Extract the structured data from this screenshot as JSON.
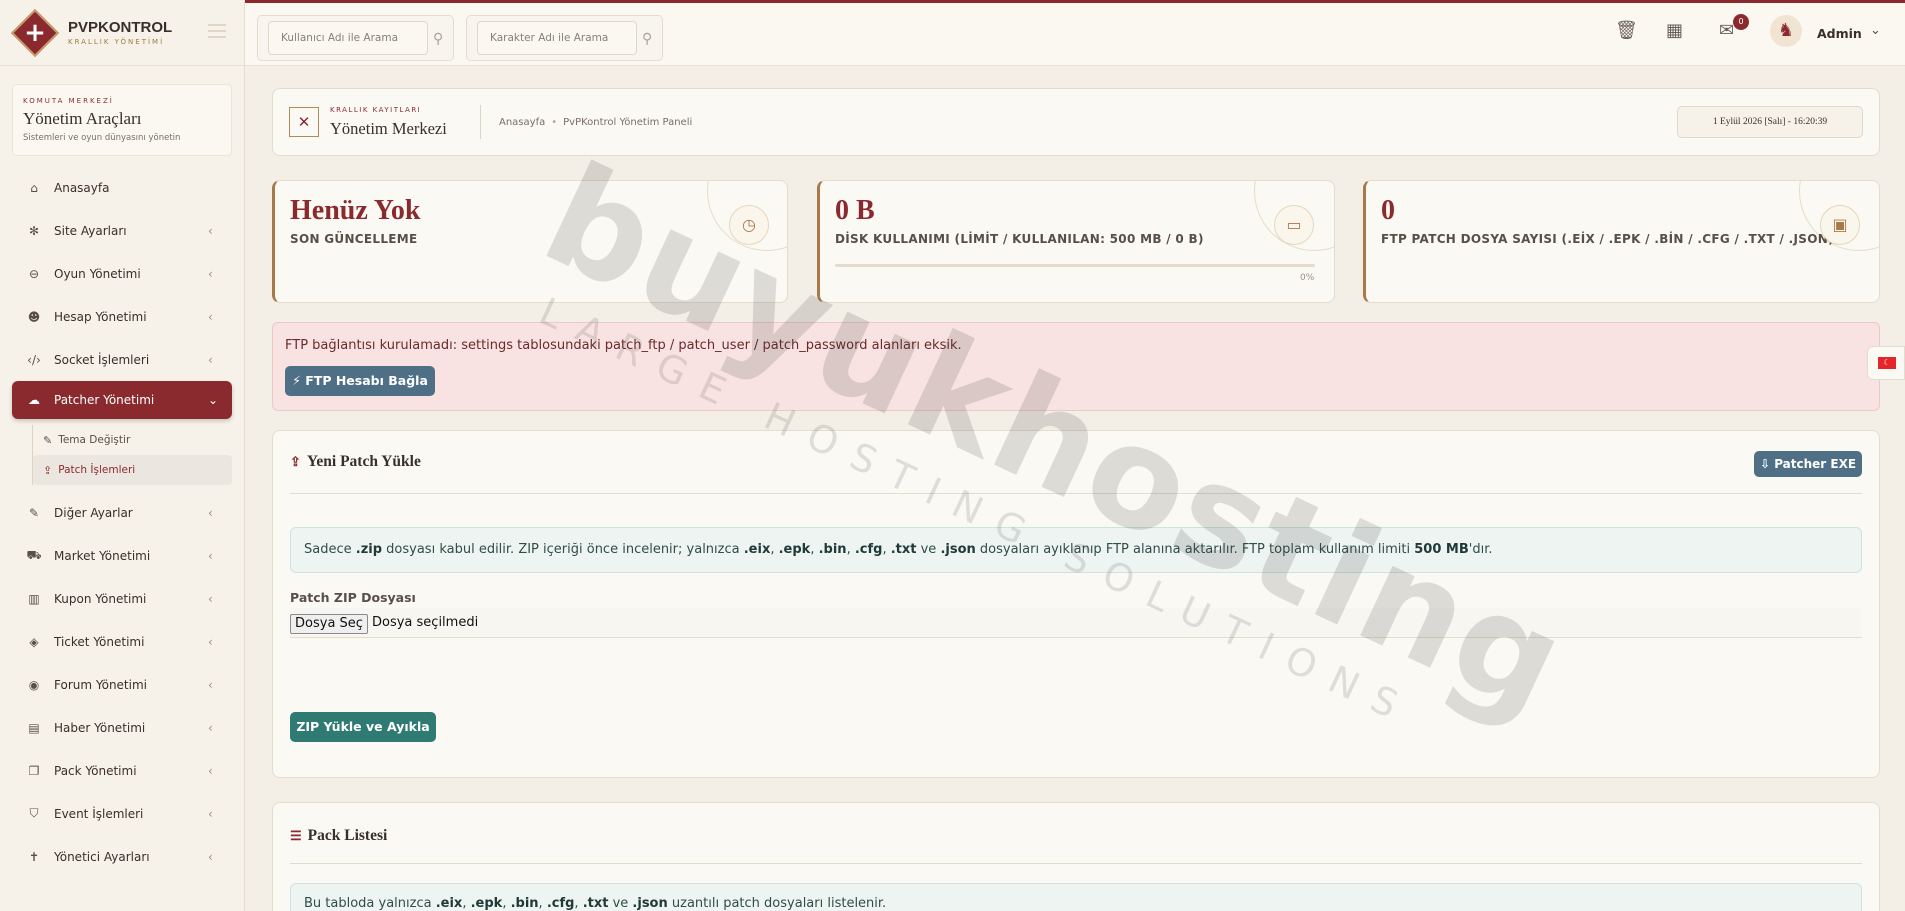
{
  "brand": {
    "title": "PVPKONTROL",
    "subtitle": "KRALLIK YÖNETİMİ"
  },
  "command_box": {
    "kicker": "KOMUTA MERKEZİ",
    "title": "Yönetim Araçları",
    "description": "Sistemleri ve oyun dünyasını yönetin"
  },
  "sidebar": {
    "items": [
      {
        "label": "Anasayfa",
        "icon": "home-icon"
      },
      {
        "label": "Site Ayarları",
        "icon": "gear-icon"
      },
      {
        "label": "Oyun Yönetimi",
        "icon": "gamepad-icon"
      },
      {
        "label": "Hesap Yönetimi",
        "icon": "users-icon"
      },
      {
        "label": "Socket İşlemleri",
        "icon": "code-icon"
      },
      {
        "label": "Patcher Yönetimi",
        "icon": "cloud-upload-icon"
      },
      {
        "label": "Diğer Ayarlar",
        "icon": "wrench-icon"
      },
      {
        "label": "Market Yönetimi",
        "icon": "cart-icon"
      },
      {
        "label": "Kupon Yönetimi",
        "icon": "barcode-icon"
      },
      {
        "label": "Ticket Yönetimi",
        "icon": "tag-icon"
      },
      {
        "label": "Forum Yönetimi",
        "icon": "comments-icon"
      },
      {
        "label": "Haber Yönetimi",
        "icon": "newspaper-icon"
      },
      {
        "label": "Pack Yönetimi",
        "icon": "copy-icon"
      },
      {
        "label": "Event İşlemleri",
        "icon": "shield-icon"
      },
      {
        "label": "Yönetici Ayarları",
        "icon": "user-tie-icon"
      }
    ],
    "sub_items": [
      {
        "label": "Tema Değiştir",
        "icon": "brush-icon"
      },
      {
        "label": "Patch İşlemleri",
        "icon": "upload-icon"
      }
    ]
  },
  "topbar": {
    "search_user_placeholder": "Kullanıcı Adı ile Arama",
    "search_char_placeholder": "Karakter Adı ile Arama",
    "notification_count": "0",
    "user_name": "Admin"
  },
  "header": {
    "kicker": "KRALLIK KAYITLARI",
    "title": "Yönetim Merkezi",
    "breadcrumb": [
      "Anasayfa",
      "PvPKontrol Yönetim Paneli"
    ],
    "datetime": "1 Eylül 2026 [Salı] - 16:20:39"
  },
  "stats": [
    {
      "value": "Henüz Yok",
      "label": "SON GÜNCELLEME",
      "icon": "clock-icon"
    },
    {
      "value": "0 B",
      "label": "DİSK KULLANIMI (LİMİT / KULLANILAN: 500 MB / 0 B)",
      "icon": "hdd-icon",
      "progress": 0,
      "progress_label": "0%"
    },
    {
      "value": "0",
      "label": "FTP PATCH DOSYA SAYISI (.EİX / .EPK / .BİN / .CFG / .TXT / .JSON)",
      "icon": "archive-icon"
    }
  ],
  "alert": {
    "text": "FTP bağlantısı kurulamadı: settings tablosundaki patch_ftp / patch_user / patch_password alanları eksik.",
    "button_label": "FTP Hesabı Bağla"
  },
  "upload_panel": {
    "title": "Yeni Patch Yükle",
    "exe_button": "Patcher EXE",
    "info": {
      "t1": "Sadece ",
      "b1": ".zip",
      "t2": " dosyası kabul edilir. ZIP içeriği önce incelenir; yalnızca ",
      "b2": ".eix",
      "t3": ", ",
      "b3": ".epk",
      "t4": ", ",
      "b4": ".bin",
      "t5": ", ",
      "b5": ".cfg",
      "t6": ", ",
      "b6": ".txt",
      "t7": " ve ",
      "b7": ".json",
      "t8": " dosyaları ayıklanıp FTP alanına aktarılır. FTP toplam kullanım limiti ",
      "b8": "500 MB",
      "t9": "'dır."
    },
    "file_label": "Patch ZIP Dosyası",
    "file_button": "Dosya Seç",
    "file_status": "Dosya seçilmedi",
    "submit_label": "ZIP Yükle ve Ayıkla"
  },
  "pack_panel": {
    "title": "Pack Listesi",
    "info": {
      "t1": "Bu tabloda yalnızca ",
      "b1": ".eix",
      "t2": ", ",
      "b2": ".epk",
      "t3": ", ",
      "b3": ".bin",
      "t4": ", ",
      "b4": ".cfg",
      "t5": ", ",
      "b5": ".txt",
      "t6": " ve ",
      "b6": ".json",
      "t7": " uzantılı patch dosyaları listelenir."
    }
  },
  "watermark": {
    "main": "buyukhosting",
    "sub": "LARGE HOSTING SOLUTIONS"
  },
  "colors": {
    "accent": "#8a2a2e",
    "gold": "#a87a4a",
    "steel": "#4f6f86",
    "teal": "#2f7a72",
    "alert_bg": "#f8e3e2"
  }
}
